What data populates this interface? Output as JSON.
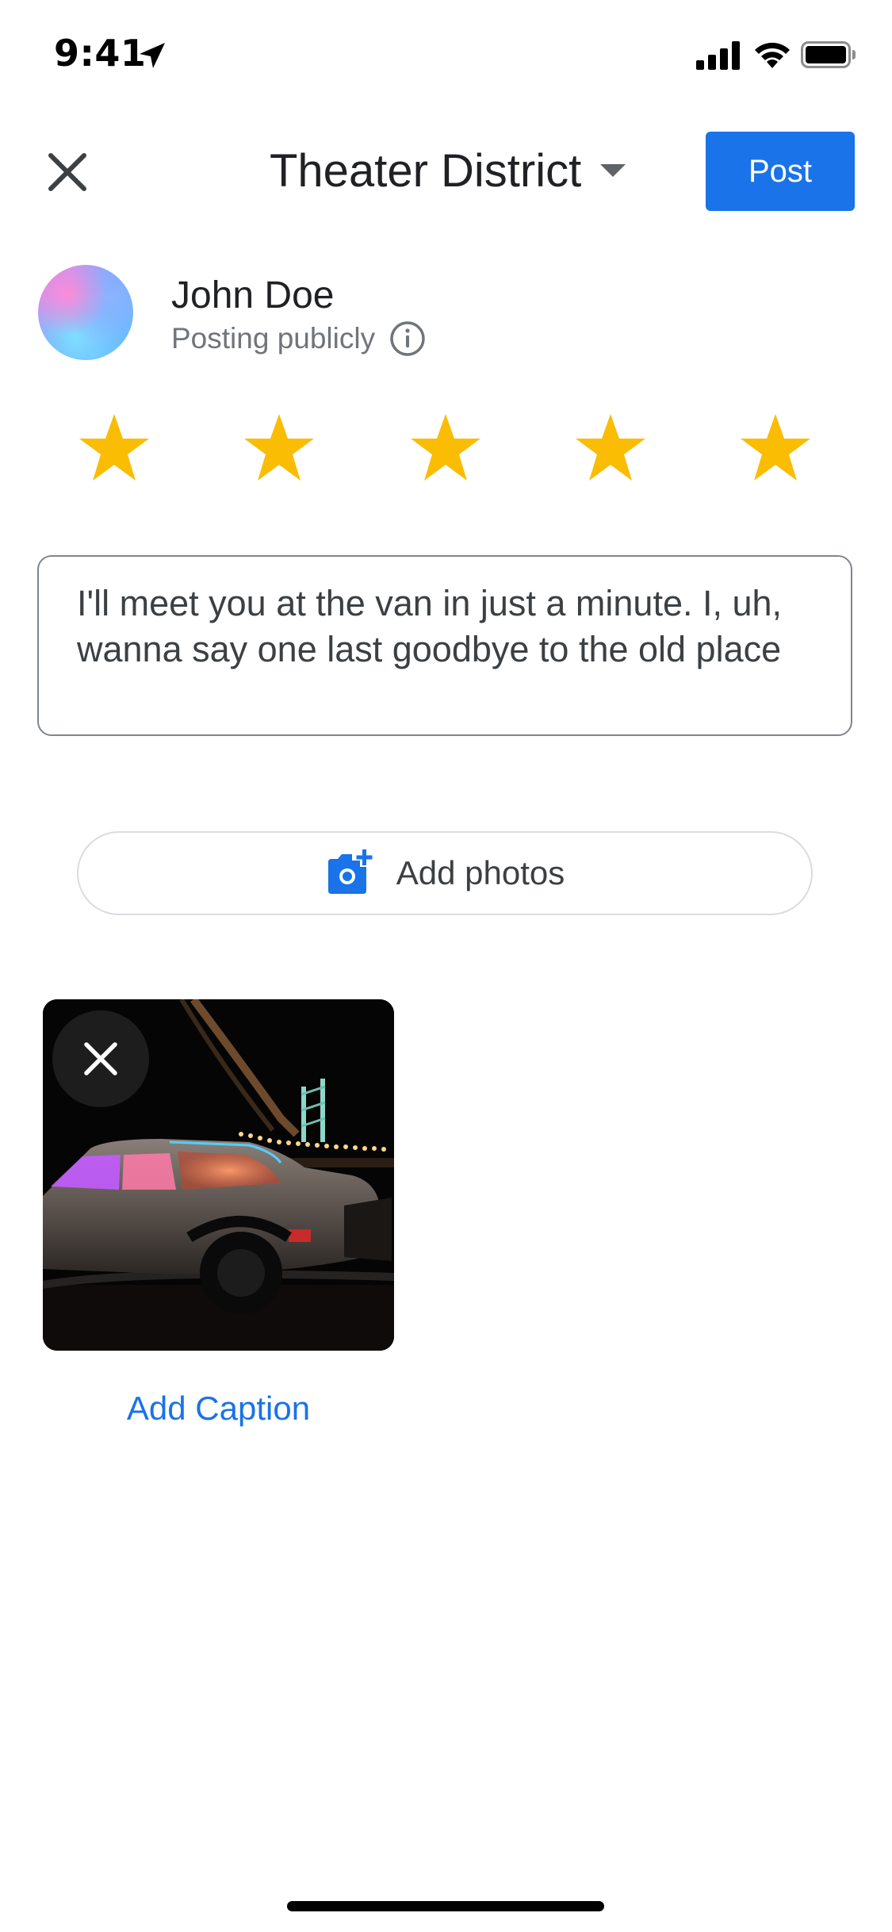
{
  "status_bar": {
    "time": "9:41"
  },
  "header": {
    "title": "Theater District",
    "post_label": "Post"
  },
  "profile": {
    "name": "John Doe",
    "visibility": "Posting publicly"
  },
  "rating": {
    "value": 5,
    "max": 5,
    "star_color": "#fbbc04"
  },
  "review": {
    "text": "I'll meet you at the van in just a minute. I, uh, wanna say one last goodbye to the old place"
  },
  "add_photos": {
    "label": "Add photos"
  },
  "photo": {
    "caption_link": "Add Caption"
  },
  "colors": {
    "accent": "#1a73e8",
    "star": "#fbbc04",
    "text_primary": "#202124",
    "text_secondary": "#70757a"
  }
}
